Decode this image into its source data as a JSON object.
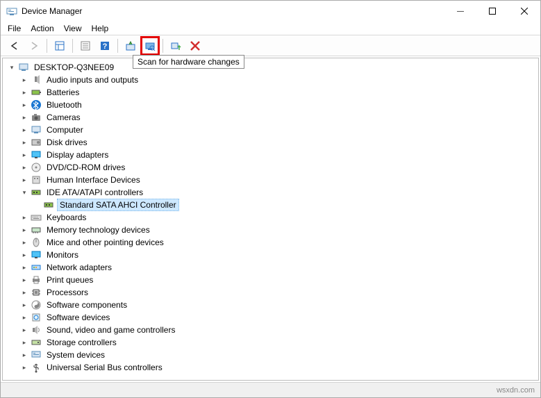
{
  "window": {
    "title": "Device Manager"
  },
  "menu": {
    "file": "File",
    "action": "Action",
    "view": "View",
    "help": "Help"
  },
  "toolbar": {
    "tooltip_scan": "Scan for hardware changes"
  },
  "tree": {
    "root": "DESKTOP-Q3NEE09",
    "nodes": [
      {
        "label": "Audio inputs and outputs",
        "icon": "audio"
      },
      {
        "label": "Batteries",
        "icon": "battery"
      },
      {
        "label": "Bluetooth",
        "icon": "bluetooth"
      },
      {
        "label": "Cameras",
        "icon": "camera"
      },
      {
        "label": "Computer",
        "icon": "computer"
      },
      {
        "label": "Disk drives",
        "icon": "disk"
      },
      {
        "label": "Display adapters",
        "icon": "display"
      },
      {
        "label": "DVD/CD-ROM drives",
        "icon": "dvd"
      },
      {
        "label": "Human Interface Devices",
        "icon": "hid"
      },
      {
        "label": "IDE ATA/ATAPI controllers",
        "icon": "ide",
        "expanded": true,
        "children": [
          {
            "label": "Standard SATA AHCI Controller",
            "icon": "ide",
            "selected": true
          }
        ]
      },
      {
        "label": "Keyboards",
        "icon": "keyboard"
      },
      {
        "label": "Memory technology devices",
        "icon": "memory"
      },
      {
        "label": "Mice and other pointing devices",
        "icon": "mouse"
      },
      {
        "label": "Monitors",
        "icon": "monitor"
      },
      {
        "label": "Network adapters",
        "icon": "network"
      },
      {
        "label": "Print queues",
        "icon": "printer"
      },
      {
        "label": "Processors",
        "icon": "cpu"
      },
      {
        "label": "Software components",
        "icon": "softcomp"
      },
      {
        "label": "Software devices",
        "icon": "softdev"
      },
      {
        "label": "Sound, video and game controllers",
        "icon": "sound"
      },
      {
        "label": "Storage controllers",
        "icon": "storage"
      },
      {
        "label": "System devices",
        "icon": "system"
      },
      {
        "label": "Universal Serial Bus controllers",
        "icon": "usb"
      }
    ]
  },
  "status": {
    "watermark": "wsxdn.com"
  }
}
